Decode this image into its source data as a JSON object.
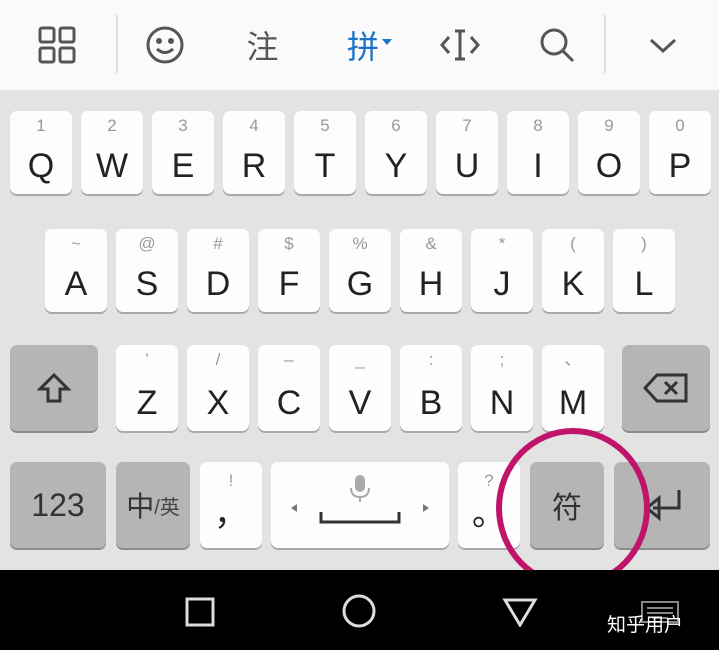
{
  "toolbar": {
    "grid_icon": "grid-icon",
    "emoji_icon": "smiley-icon",
    "annotate_label": "注",
    "pinyin_label": "拼",
    "cursor_icon": "cursor-move-icon",
    "search_icon": "search-icon",
    "collapse_icon": "chevron-down-icon",
    "accent_color": "#1a73c8"
  },
  "rows": {
    "row1": [
      {
        "main": "Q",
        "sub": "1"
      },
      {
        "main": "W",
        "sub": "2"
      },
      {
        "main": "E",
        "sub": "3"
      },
      {
        "main": "R",
        "sub": "4"
      },
      {
        "main": "T",
        "sub": "5"
      },
      {
        "main": "Y",
        "sub": "6"
      },
      {
        "main": "U",
        "sub": "7"
      },
      {
        "main": "I",
        "sub": "8"
      },
      {
        "main": "O",
        "sub": "9"
      },
      {
        "main": "P",
        "sub": "0"
      }
    ],
    "row2": [
      {
        "main": "A",
        "sub": "~"
      },
      {
        "main": "S",
        "sub": "@"
      },
      {
        "main": "D",
        "sub": "#"
      },
      {
        "main": "F",
        "sub": "$"
      },
      {
        "main": "G",
        "sub": "%"
      },
      {
        "main": "H",
        "sub": "&"
      },
      {
        "main": "J",
        "sub": "*"
      },
      {
        "main": "K",
        "sub": "("
      },
      {
        "main": "L",
        "sub": ")"
      }
    ],
    "row3": [
      {
        "main": "Z",
        "sub": "’"
      },
      {
        "main": "X",
        "sub": "/"
      },
      {
        "main": "C",
        "sub": "–"
      },
      {
        "main": "V",
        "sub": "_"
      },
      {
        "main": "B",
        "sub": ":"
      },
      {
        "main": "N",
        "sub": ";"
      },
      {
        "main": "M",
        "sub": "、"
      }
    ]
  },
  "bottom": {
    "num_label": "123",
    "zh_label": "中",
    "en_label": "/英",
    "comma_main": "，",
    "comma_sub": "!",
    "period_main": "。",
    "period_sub": "?",
    "symbol_label": "符"
  },
  "watermark": "知乎用户",
  "annotation_color": "#c0136a"
}
